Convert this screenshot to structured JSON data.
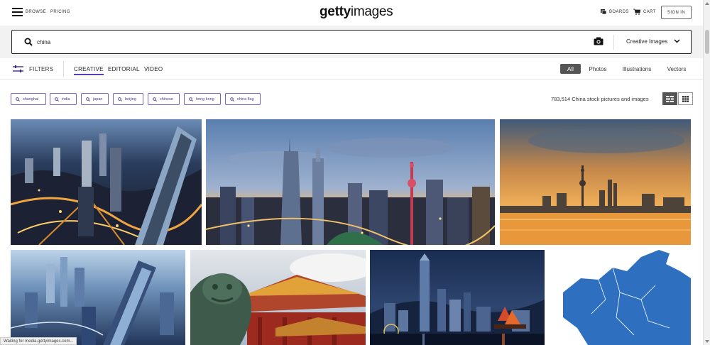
{
  "header": {
    "browse": "BROWSE",
    "pricing": "PRICING",
    "logo_bold": "getty",
    "logo_light": "images",
    "boards": "BOARDS",
    "cart": "CART",
    "signin": "SIGN IN"
  },
  "search": {
    "query": "china",
    "type_label": "Creative Images"
  },
  "filters": {
    "label": "FILTERS",
    "categories": [
      "CREATIVE",
      "EDITORIAL",
      "VIDEO"
    ],
    "active_category": "CREATIVE",
    "media_types": [
      "All",
      "Photos",
      "Illustrations",
      "Vectors"
    ],
    "active_media_type": "All"
  },
  "related_searches": [
    "shanghai",
    "india",
    "japan",
    "beijing",
    "chinese",
    "hong kong",
    "china flag"
  ],
  "results": {
    "count_text": "783,514 China stock pictures and images"
  },
  "images": [
    {
      "subject": "shanghai-aerial-night"
    },
    {
      "subject": "shanghai-skyline-dusk"
    },
    {
      "subject": "shanghai-bund-sunset"
    },
    {
      "subject": "shanghai-aerial-blue"
    },
    {
      "subject": "forbidden-city-lion"
    },
    {
      "subject": "hong-kong-harbour-night"
    },
    {
      "subject": "china-map-blue"
    }
  ],
  "colors": {
    "accent": "#5b3fb5",
    "map_blue": "#2f6fc0",
    "segment_active": "#555555"
  },
  "statusbar": {
    "text": "Waiting for media.gettyimages.com..."
  }
}
